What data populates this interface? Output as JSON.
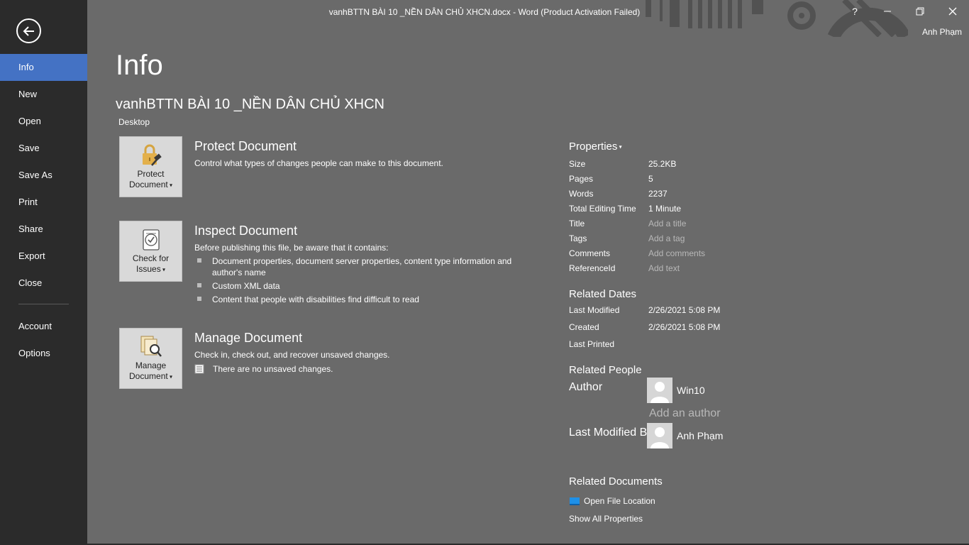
{
  "titlebar": {
    "title": "vanhBTTN BÀI 10 _NỀN DÂN CHỦ XHCN.docx - Word (Product Activation Failed)",
    "help": "?",
    "minimize": "—",
    "restore": "❐",
    "close": "✕",
    "user": "Anh Phạm"
  },
  "sidebar": {
    "items": [
      {
        "label": "Info"
      },
      {
        "label": "New"
      },
      {
        "label": "Open"
      },
      {
        "label": "Save"
      },
      {
        "label": "Save As"
      },
      {
        "label": "Print"
      },
      {
        "label": "Share"
      },
      {
        "label": "Export"
      },
      {
        "label": "Close"
      },
      {
        "label": "Account"
      },
      {
        "label": "Options"
      }
    ]
  },
  "main": {
    "page_title": "Info",
    "doc_title": "vanhBTTN BÀI 10 _NỀN DÂN CHỦ XHCN",
    "doc_location": "Desktop",
    "protect": {
      "tile_line1": "Protect",
      "tile_line2": "Document",
      "heading": "Protect Document",
      "desc": "Control what types of changes people can make to this document."
    },
    "inspect": {
      "tile_line1": "Check for",
      "tile_line2": "Issues",
      "heading": "Inspect Document",
      "desc": "Before publishing this file, be aware that it contains:",
      "bullets": [
        "Document properties, document server properties, content type information and author's name",
        "Custom XML data",
        "Content that people with disabilities find difficult to read"
      ]
    },
    "manage": {
      "tile_line1": "Manage",
      "tile_line2": "Document",
      "heading": "Manage Document",
      "desc": "Check in, check out, and recover unsaved changes.",
      "status": "There are no unsaved changes."
    }
  },
  "properties": {
    "heading": "Properties",
    "rows": [
      {
        "label": "Size",
        "value": "25.2KB"
      },
      {
        "label": "Pages",
        "value": "5"
      },
      {
        "label": "Words",
        "value": "2237"
      },
      {
        "label": "Total Editing Time",
        "value": "1 Minute"
      },
      {
        "label": "Title",
        "value": "Add a title"
      },
      {
        "label": "Tags",
        "value": "Add a tag"
      },
      {
        "label": "Comments",
        "value": "Add comments"
      },
      {
        "label": "ReferenceId",
        "value": "Add text"
      }
    ],
    "dates_heading": "Related Dates",
    "dates": [
      {
        "label": "Last Modified",
        "value": "2/26/2021 5:08 PM"
      },
      {
        "label": "Created",
        "value": "2/26/2021 5:08 PM"
      },
      {
        "label": "Last Printed",
        "value": ""
      }
    ],
    "people_heading": "Related People",
    "author_label": "Author",
    "author_name": "Win10",
    "add_author": "Add an author",
    "modified_by_label": "Last Modified By",
    "modified_by_name": "Anh Phạm",
    "docs_heading": "Related Documents",
    "open_location": "Open File Location",
    "show_all": "Show All Properties"
  },
  "colors": {
    "sidebar_bg": "#2b2b2b",
    "active_item": "#4472c4",
    "content_bg": "#6a6a6a"
  }
}
